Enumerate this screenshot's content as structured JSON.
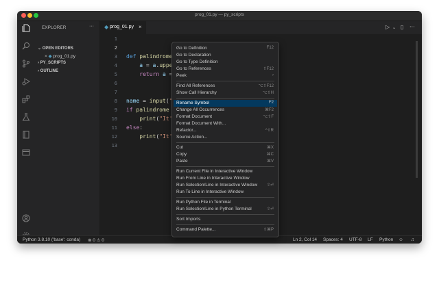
{
  "window": {
    "title": "prog_01.py — py_scripts"
  },
  "sidebar": {
    "title": "EXPLORER",
    "more": "···",
    "sections": [
      "OPEN EDITORS",
      "PY_SCRIPTS",
      "OUTLINE"
    ],
    "open_file": "prog_01.py"
  },
  "tab": {
    "label": "prog_01.py",
    "close": "×"
  },
  "editor": {
    "line_numbers": [
      "1",
      "2",
      "3",
      "4",
      "5",
      "6",
      "7",
      "8",
      "9",
      "10",
      "11",
      "12",
      "13"
    ],
    "current_line": "2"
  },
  "icons": {
    "explorer": "files-icon",
    "search": "search-icon",
    "scm": "source-control-icon",
    "run": "run-debug-icon",
    "extensions": "extensions-icon",
    "test": "testing-icon",
    "remote": "remote-explorer-icon",
    "account": "account-icon",
    "settings": "gear-icon",
    "python": "python-file-icon"
  },
  "context_menu": {
    "items": [
      {
        "label": "Go to Definition",
        "key": "F12"
      },
      {
        "label": "Go to Declaration",
        "key": ""
      },
      {
        "label": "Go to Type Definition",
        "key": ""
      },
      {
        "label": "Go to References",
        "key": "⇧F12"
      },
      {
        "label": "Peek",
        "key": "›"
      },
      {
        "label": "Find All References",
        "key": "⌥⇧F12"
      },
      {
        "label": "Show Call Hierarchy",
        "key": "⌥⇧H"
      },
      {
        "label": "Rename Symbol",
        "key": "F2"
      },
      {
        "label": "Change All Occurrences",
        "key": "⌘F2"
      },
      {
        "label": "Format Document",
        "key": "⌥⇧F"
      },
      {
        "label": "Format Document With...",
        "key": ""
      },
      {
        "label": "Refactor...",
        "key": "^⇧R"
      },
      {
        "label": "Source Action...",
        "key": ""
      },
      {
        "label": "Cut",
        "key": "⌘X"
      },
      {
        "label": "Copy",
        "key": "⌘C"
      },
      {
        "label": "Paste",
        "key": "⌘V"
      },
      {
        "label": "Run Current File in Interactive Window",
        "key": ""
      },
      {
        "label": "Run From Line in Interactive Window",
        "key": ""
      },
      {
        "label": "Run Selection/Line in Interactive Window",
        "key": "⇧⏎"
      },
      {
        "label": "Run To Line in Interactive Window",
        "key": ""
      },
      {
        "label": "Run Python File in Terminal",
        "key": ""
      },
      {
        "label": "Run Selection/Line in Python Terminal",
        "key": "⇧⏎"
      },
      {
        "label": "Sort Imports",
        "key": ""
      },
      {
        "label": "Command Palette...",
        "key": "⇧⌘P"
      }
    ],
    "highlighted": "Rename Symbol"
  },
  "statusbar": {
    "interpreter": "Python 3.8.10 ('base': conda)",
    "problems": "⊗ 0 ⚠ 0",
    "position": "Ln 2, Col 14",
    "spaces": "Spaces: 4",
    "encoding": "UTF-8",
    "eol": "LF",
    "language": "Python"
  },
  "colors": {
    "highlight": "#04395e",
    "background": "#1e1e1e",
    "sidebar": "#252526"
  }
}
